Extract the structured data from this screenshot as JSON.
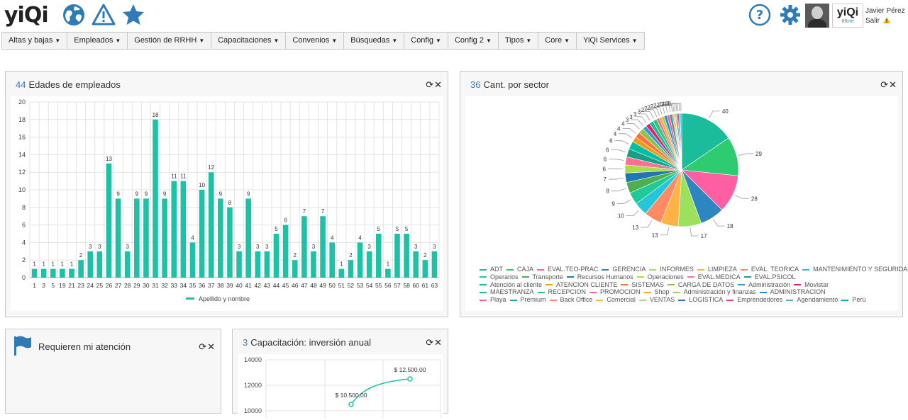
{
  "header": {
    "logo": "yiQi",
    "user_name": "Javier Pérez",
    "logout": "Salir",
    "company_logo": "yiQi",
    "company_logo_sub": "RRHH"
  },
  "nav": [
    {
      "label": "Altas y bajas"
    },
    {
      "label": "Empleados"
    },
    {
      "label": "Gestión de RRHH"
    },
    {
      "label": "Capacitaciones"
    },
    {
      "label": "Convenios"
    },
    {
      "label": "Búsquedas"
    },
    {
      "label": "Config"
    },
    {
      "label": "Config 2"
    },
    {
      "label": "Tipos"
    },
    {
      "label": "Core"
    },
    {
      "label": "YiQi Services"
    }
  ],
  "colors": {
    "accent": "#2e7bb8",
    "bar": "#1fc1a6",
    "warning": "#2e7bb8"
  },
  "panels": {
    "ages": {
      "count": "44",
      "title": "Edades de empleados"
    },
    "sector": {
      "count": "36",
      "title": "Cant. por sector"
    },
    "attention": {
      "title": "Requieren mi atención"
    },
    "training": {
      "count": "3",
      "title": "Capacitación: inversión anual"
    }
  },
  "chart_data": [
    {
      "type": "bar",
      "categories": [
        "1",
        "3",
        "5",
        "19",
        "21",
        "23",
        "24",
        "25",
        "26",
        "27",
        "28",
        "29",
        "30",
        "31",
        "32",
        "33",
        "34",
        "35",
        "36",
        "37",
        "38",
        "39",
        "40",
        "41",
        "42",
        "43",
        "44",
        "45",
        "46",
        "47",
        "48",
        "49",
        "50",
        "51",
        "52",
        "53",
        "54",
        "55",
        "56",
        "57",
        "58",
        "60",
        "61",
        "63"
      ],
      "series": [
        {
          "name": "Apellido y nombre",
          "values": [
            1,
            1,
            1,
            1,
            1,
            2,
            3,
            3,
            13,
            9,
            3,
            9,
            9,
            18,
            9,
            11,
            11,
            4,
            10,
            12,
            9,
            8,
            3,
            9,
            3,
            3,
            5,
            6,
            2,
            7,
            3,
            7,
            4,
            1,
            2,
            4,
            3,
            5,
            1,
            5,
            5,
            3,
            2,
            3
          ]
        }
      ],
      "ylim": [
        0,
        20
      ],
      "yticks": [
        0,
        2,
        4,
        6,
        8,
        10,
        12,
        14,
        16,
        18,
        20
      ],
      "grid": true,
      "legend_placement": "bottom"
    },
    {
      "type": "pie",
      "slices": [
        {
          "label": "ADT",
          "value": 40,
          "color": "#1abc9c"
        },
        {
          "label": "CAJA",
          "value": 29,
          "color": "#2ecc71"
        },
        {
          "label": "EVAL.TEO-PRAC",
          "value": 28,
          "color": "#ff5fa2"
        },
        {
          "label": "GERENCIA",
          "value": 18,
          "color": "#2e86c1"
        },
        {
          "label": "INFORMES",
          "value": 17,
          "color": "#9be15d"
        },
        {
          "label": "LIMPIEZA",
          "value": 13,
          "color": "#ffb347"
        },
        {
          "label": "EVAL. TEORICA",
          "value": 13,
          "color": "#ff8a65"
        },
        {
          "label": "MANTENIMIENTO Y SEGURIDAD",
          "value": 10,
          "color": "#26c6da"
        },
        {
          "label": "Operarios",
          "value": 9,
          "color": "#20c997"
        },
        {
          "label": "Transporte",
          "value": 8,
          "color": "#4caf50"
        },
        {
          "label": "Recursos Humanos",
          "value": 7,
          "color": "#1f78b4"
        },
        {
          "label": "Operaciones",
          "value": 6,
          "color": "#a3e048"
        },
        {
          "label": "EVAL.MEDICA",
          "value": 6,
          "color": "#ff6f91"
        },
        {
          "label": "EVAL.PSICOL",
          "value": 6,
          "color": "#16a085"
        },
        {
          "label": "Atención al cliente",
          "value": 6,
          "color": "#00bfa5"
        },
        {
          "label": "ATENCION CLIENTE",
          "value": 4,
          "color": "#f39c12"
        },
        {
          "label": "SISTEMAS",
          "value": 4,
          "color": "#ff7043"
        },
        {
          "label": "CARGA DE DATOS",
          "value": 4,
          "color": "#8bc34a"
        },
        {
          "label": "Administración",
          "value": 3,
          "color": "#3498db"
        },
        {
          "label": "Movistar",
          "value": 3,
          "color": "#e91e63"
        },
        {
          "label": "MAESTRANZA",
          "value": 3,
          "color": "#1abc9c"
        },
        {
          "label": "RECEPCION",
          "value": 3,
          "color": "#2ecc71"
        },
        {
          "label": "PROMOCION",
          "value": 2,
          "color": "#ff5fa2"
        },
        {
          "label": "Shop",
          "value": 2,
          "color": "#ffa726"
        },
        {
          "label": "Administración y finanzas",
          "value": 2,
          "color": "#9ccc65"
        },
        {
          "label": "ADMINISTRACION",
          "value": 2,
          "color": "#1e88e5"
        },
        {
          "label": "Playa",
          "value": 2,
          "color": "#f06292"
        },
        {
          "label": "Premium",
          "value": 2,
          "color": "#26a69a"
        },
        {
          "label": "Back Office",
          "value": 1,
          "color": "#ff8a65"
        },
        {
          "label": "Comercial",
          "value": 1,
          "color": "#ffb74d"
        },
        {
          "label": "VENTAS",
          "value": 1,
          "color": "#aed581"
        },
        {
          "label": "LOGISTICA",
          "value": 1,
          "color": "#1976d2"
        },
        {
          "label": "Emprendedores",
          "value": 1,
          "color": "#ec407a"
        },
        {
          "label": "Agendamiento",
          "value": 1,
          "color": "#4db6ac"
        },
        {
          "label": "Perú",
          "value": 1,
          "color": "#00acc1"
        }
      ],
      "legend_placement": "bottom"
    },
    {
      "type": "line",
      "y_ticks": [
        10000,
        12000,
        14000
      ],
      "y_tick_labels": [
        "10000",
        "12000",
        "14000"
      ],
      "points": [
        {
          "value": 10500,
          "label": "$ 10.500,00"
        },
        {
          "value": 12500,
          "label": "$ 12.500,00"
        }
      ]
    }
  ]
}
